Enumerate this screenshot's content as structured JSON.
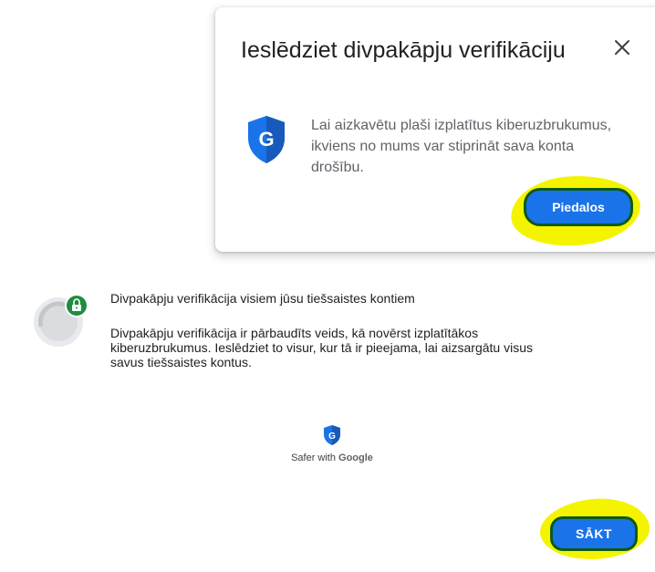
{
  "popup": {
    "title": "Ieslēdziet divpakāpju verifikāciju",
    "body": "Lai aizkavētu plaši izplatītus kiberuzbrukumus, ikviens no mums var stiprināt sava konta drošību.",
    "join_label": "Piedalos",
    "close_icon": "close-icon",
    "shield_icon": "google-shield-icon"
  },
  "main": {
    "title": "Divpakāpju verifikācija visiem jūsu tiešsaistes kontiem",
    "description": "Divpakāpju verifikācija ir pārbaudīts veids, kā novērst izplatītākos kiberuzbrukumus. Ieslēdziet to visur, kur tā ir pieejama, lai aizsargātu visus savus tiešsaistes kontus.",
    "avatar_icon": "lock-avatar-icon",
    "footer_prefix": "Safer with ",
    "footer_brand": "Google",
    "start_label": "SĀKT"
  },
  "colors": {
    "accent": "#1a73e8",
    "highlight": "#f4f400",
    "lock_green": "#1e8e3e"
  }
}
